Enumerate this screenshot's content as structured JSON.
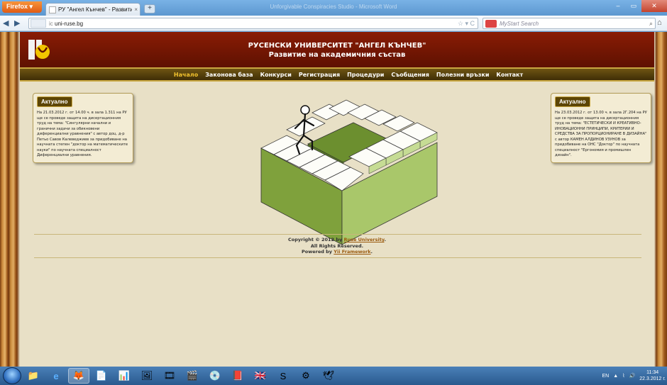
{
  "browser": {
    "menu_label": "Firefox",
    "tab_title": "РУ \"Ангел Кънчев\" - Развитие ...",
    "window_title": "Unforgivable Conspiracies Studio - Microsoft Word",
    "url": "uni-ruse.bg",
    "search_placeholder": "MyStart Search",
    "url_prefix": "ic"
  },
  "site": {
    "title": "РУСЕНСКИ УНИВЕРСИТЕТ \"АНГЕЛ КЪНЧЕВ\"",
    "subtitle": "Развитие на академичния състав",
    "menu": [
      {
        "label": "Начало",
        "active": true
      },
      {
        "label": "Законова база"
      },
      {
        "label": "Конкурси"
      },
      {
        "label": "Регистрация"
      },
      {
        "label": "Процедури"
      },
      {
        "label": "Съобщения"
      },
      {
        "label": "Полезни връзки"
      },
      {
        "label": "Контакт"
      }
    ],
    "news_left": {
      "heading": "Актуално",
      "text": "На 21.03.2012 г. от 14.00 ч. в зала 1.311 на РУ ще се проведе защита на дисертационния труд на тема: \"Сингулярни начални и гранични задачи за обикновени диференциални уравнения\" с автор доц. д-р Петьо Савов Калеведжиев за придобиване на научната степен \"доктор на математическите науки\" по научната специалност Диференциални уравнения."
    },
    "news_right": {
      "heading": "Актуално",
      "text": "На 23.03.2012 г. от 13.00 ч. в зала 2Г.204 на РУ ще се проведе защита на дисертационния труд на тема: \"ЕСТЕТИЧЕСКИ И КРЕАТИВНО-ИНОВАЦИОННИ ПРИНЦИПИ, КРИТЕРИИ И СРЕДСТВА ЗА ПРОПОРЦИОНИРАНЕ В ДИЗАЙНА\" с автор КАМЕН АЛДИНОВ УЗУНОВ за придобиване на ОНС \"Доктор\" по научната специалност \"Ергономия и промишлен дизайн\"."
    },
    "footer": {
      "copyright_prefix": "Copyright © 2012 by",
      "copyright_link": "Ruse University",
      "rights": "All Rights Reserved.",
      "powered_prefix": "Powered by",
      "powered_link": "Yii Framework"
    }
  },
  "taskbar": {
    "language": "EN",
    "time": "11:34",
    "date": "22.3.2012 г."
  },
  "colors": {
    "header_bg": "#7a1a03",
    "menu_bg": "#5a4308",
    "menu_active": "#f0c12e",
    "page_bg": "#e8e0c6"
  }
}
